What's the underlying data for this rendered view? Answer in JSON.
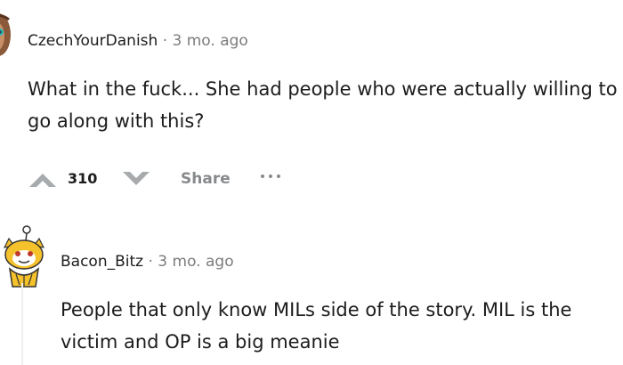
{
  "comments": [
    {
      "username": "CzechYourDanish",
      "separator": "·",
      "time": "3 mo. ago",
      "body": "What in the fuck... She had people who were actually willing to go along with this?",
      "score": "310",
      "share_label": "Share"
    },
    {
      "username": "Bacon_Bitz",
      "separator": "·",
      "time": "3 mo. ago",
      "body": "People that only know MILs side of the story. MIL is the victim and OP is a big meanie"
    }
  ],
  "icons": {
    "avatar1": "user-avatar-icon",
    "upvote": "upvote-arrow-icon",
    "downvote": "downvote-arrow-icon",
    "more": "more-options-icon",
    "avatar2": "snoo-avatar-icon"
  },
  "colors": {
    "text": "#1c1c1c",
    "meta": "#7c7c7c",
    "action": "#878a8c",
    "thread_line": "#edeff1"
  }
}
